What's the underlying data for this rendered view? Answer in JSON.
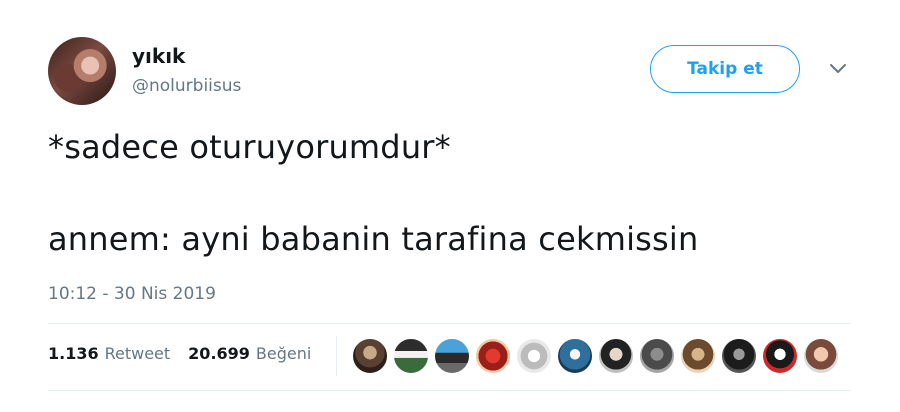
{
  "user": {
    "display_name": "yıkık",
    "handle": "@nolurbiisus"
  },
  "follow_button": {
    "label": "Takip et"
  },
  "tweet": {
    "line1": "*sadece oturuyorumdur*",
    "line2": "annem: ayni babanin tarafina cekmissin",
    "timestamp": "10:12 - 30 Nis 2019"
  },
  "stats": {
    "retweet_count": "1.136",
    "retweet_label": "Retweet",
    "like_count": "20.699",
    "like_label": "Beğeni"
  },
  "icons": {
    "more": "chevron-down-icon"
  },
  "colors": {
    "accent": "#1da1f2",
    "secondary_text": "#657786",
    "divider": "#e6ecf0"
  }
}
